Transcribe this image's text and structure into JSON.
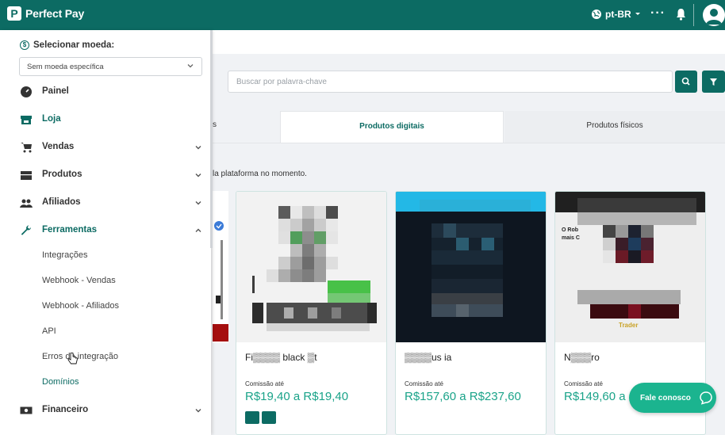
{
  "topbar": {
    "logo_mark": "P",
    "app_name": "Perfect Pay",
    "language": "pt-BR",
    "more": "···",
    "brand_color": "#0c6b63"
  },
  "sidebar": {
    "currency_title": "Selecionar moeda:",
    "currency_symbol": "$",
    "currency_value": "Sem moeda específica",
    "nav": [
      {
        "label": "Painel",
        "icon": "dashboard-icon"
      },
      {
        "label": "Loja",
        "icon": "store-icon"
      },
      {
        "label": "Vendas",
        "icon": "cart-icon"
      },
      {
        "label": "Produtos",
        "icon": "box-icon"
      },
      {
        "label": "Afiliados",
        "icon": "users-icon"
      },
      {
        "label": "Ferramentas",
        "icon": "wrench-icon"
      },
      {
        "label": "Financeiro",
        "icon": "money-icon"
      }
    ],
    "tools_sub": [
      "Integrações",
      "Webhook - Vendas",
      "Webhook - Afiliados",
      "API",
      "Erros de integração",
      "Domínios"
    ]
  },
  "main": {
    "search_placeholder": "Buscar por palavra-chave",
    "tab_partial": "s",
    "tabs": [
      "Produtos digitais",
      "Produtos físicos"
    ],
    "note": "la plataforma no momento.",
    "cards": [
      {
        "name": "Fi▒▒▒▒ black ▒t",
        "commission_label": "Comissão até",
        "price": "R$19,40 a R$19,40"
      },
      {
        "name": "▒▒▒▒us ia",
        "commission_label": "Comissão até",
        "price": "R$157,60 a R$237,60"
      },
      {
        "name": "N▒▒▒ro",
        "commission_label": "Comissão até",
        "price": "R$149,60 a",
        "image_caption": "Trader",
        "image_text": "O Rob\nmais C"
      }
    ]
  },
  "chat": {
    "label": "Fale conosco",
    "color": "#1bb48f"
  }
}
